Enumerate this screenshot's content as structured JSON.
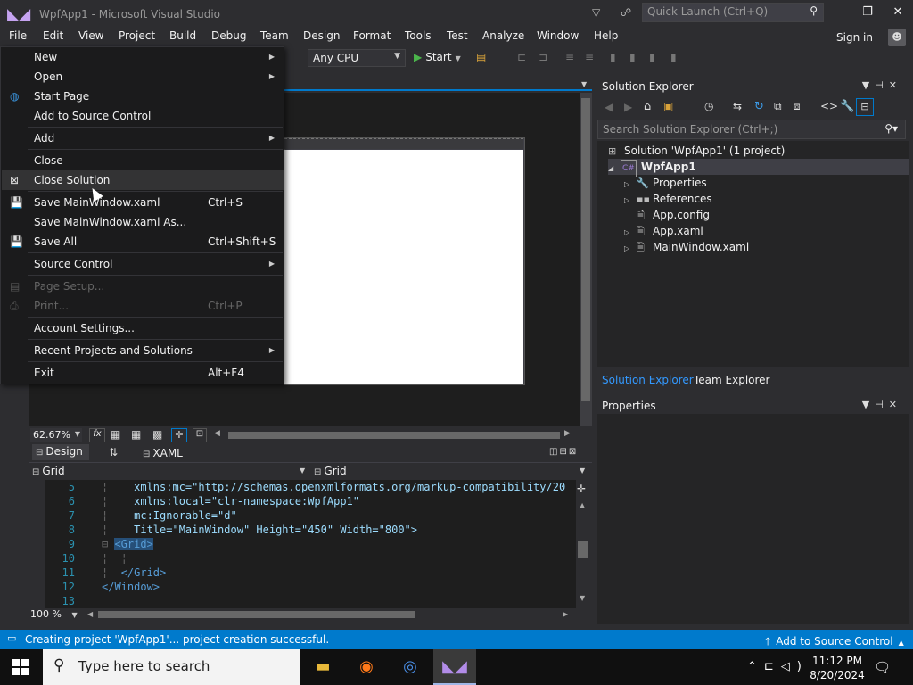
{
  "window": {
    "title": "WpfApp1 - Microsoft Visual Studio",
    "quick_launch_placeholder": "Quick Launch (Ctrl+Q)"
  },
  "menubar": [
    "File",
    "Edit",
    "View",
    "Project",
    "Build",
    "Debug",
    "Team",
    "Design",
    "Format",
    "Tools",
    "Test",
    "Analyze",
    "Window",
    "Help"
  ],
  "account": {
    "sign_in": "Sign in"
  },
  "toolbar": {
    "platform": "Any CPU",
    "start": "Start"
  },
  "file_menu": [
    {
      "label": "New",
      "submenu": true
    },
    {
      "label": "Open",
      "submenu": true
    },
    {
      "label": "Start Page",
      "icon": "globe-icon"
    },
    {
      "label": "Add to Source Control"
    },
    {
      "label": "Add",
      "submenu": true
    },
    {
      "label": "Close"
    },
    {
      "label": "Close Solution",
      "icon": "close-solution-icon",
      "highlighted": true
    },
    {
      "label": "Save MainWindow.xaml",
      "shortcut": "Ctrl+S",
      "icon": "save-icon"
    },
    {
      "label": "Save MainWindow.xaml As..."
    },
    {
      "label": "Save All",
      "shortcut": "Ctrl+Shift+S",
      "icon": "save-all-icon"
    },
    {
      "label": "Source Control",
      "submenu": true
    },
    {
      "label": "Page Setup...",
      "disabled": true,
      "icon": "page-setup-icon"
    },
    {
      "label": "Print...",
      "shortcut": "Ctrl+P",
      "disabled": true,
      "icon": "print-icon"
    },
    {
      "label": "Account Settings..."
    },
    {
      "label": "Recent Projects and Solutions",
      "submenu": true
    },
    {
      "label": "Exit",
      "shortcut": "Alt+F4"
    }
  ],
  "designer": {
    "zoom": "62.67%",
    "fx": "fx",
    "tab_design": "Design",
    "tab_xaml": "XAML",
    "swap": "⇅"
  },
  "editor": {
    "breadcrumb_left": "Grid",
    "breadcrumb_right": "Grid",
    "zoom": "100 %",
    "lines": [
      {
        "n": "5",
        "text": "xmlns:mc=\"http://schemas.openxmlformats.org/markup-compatibility/20"
      },
      {
        "n": "6",
        "text": "xmlns:local=\"clr-namespace:WpfApp1\""
      },
      {
        "n": "7",
        "text": "mc:Ignorable=\"d\""
      },
      {
        "n": "8",
        "text": "Title=\"MainWindow\" Height=\"450\" Width=\"800\">"
      },
      {
        "n": "9",
        "text": "<Grid>"
      },
      {
        "n": "10",
        "text": ""
      },
      {
        "n": "11",
        "text": "</Grid>"
      },
      {
        "n": "12",
        "text": "</Window>"
      },
      {
        "n": "13",
        "text": ""
      }
    ]
  },
  "solution_explorer": {
    "title": "Solution Explorer",
    "search_placeholder": "Search Solution Explorer (Ctrl+;)",
    "nodes": [
      {
        "label": "Solution 'WpfApp1' (1 project)",
        "icon": "solution-icon",
        "level": 0
      },
      {
        "label": "WpfApp1",
        "icon": "csharp-project-icon",
        "level": 1,
        "expanded": true,
        "selected": true
      },
      {
        "label": "Properties",
        "icon": "wrench-icon",
        "level": 2,
        "expandable": true
      },
      {
        "label": "References",
        "icon": "references-icon",
        "level": 2,
        "expandable": true
      },
      {
        "label": "App.config",
        "icon": "config-file-icon",
        "level": 2
      },
      {
        "label": "App.xaml",
        "icon": "xaml-file-icon",
        "level": 2,
        "expandable": true
      },
      {
        "label": "MainWindow.xaml",
        "icon": "xaml-file-icon",
        "level": 2,
        "expandable": true
      }
    ],
    "tabs": [
      "Solution Explorer",
      "Team Explorer"
    ]
  },
  "properties": {
    "title": "Properties"
  },
  "status": {
    "message": "Creating project 'WpfApp1'... project creation successful.",
    "source_control": "Add to Source Control"
  },
  "taskbar": {
    "search_placeholder": "Type here to search",
    "time": "11:12 PM",
    "date": "8/20/2024"
  },
  "colors": {
    "accent": "#007acc",
    "menu_bg": "#1b1b1c",
    "editor_bg": "#1e1e1e",
    "chrome": "#2d2d30"
  }
}
